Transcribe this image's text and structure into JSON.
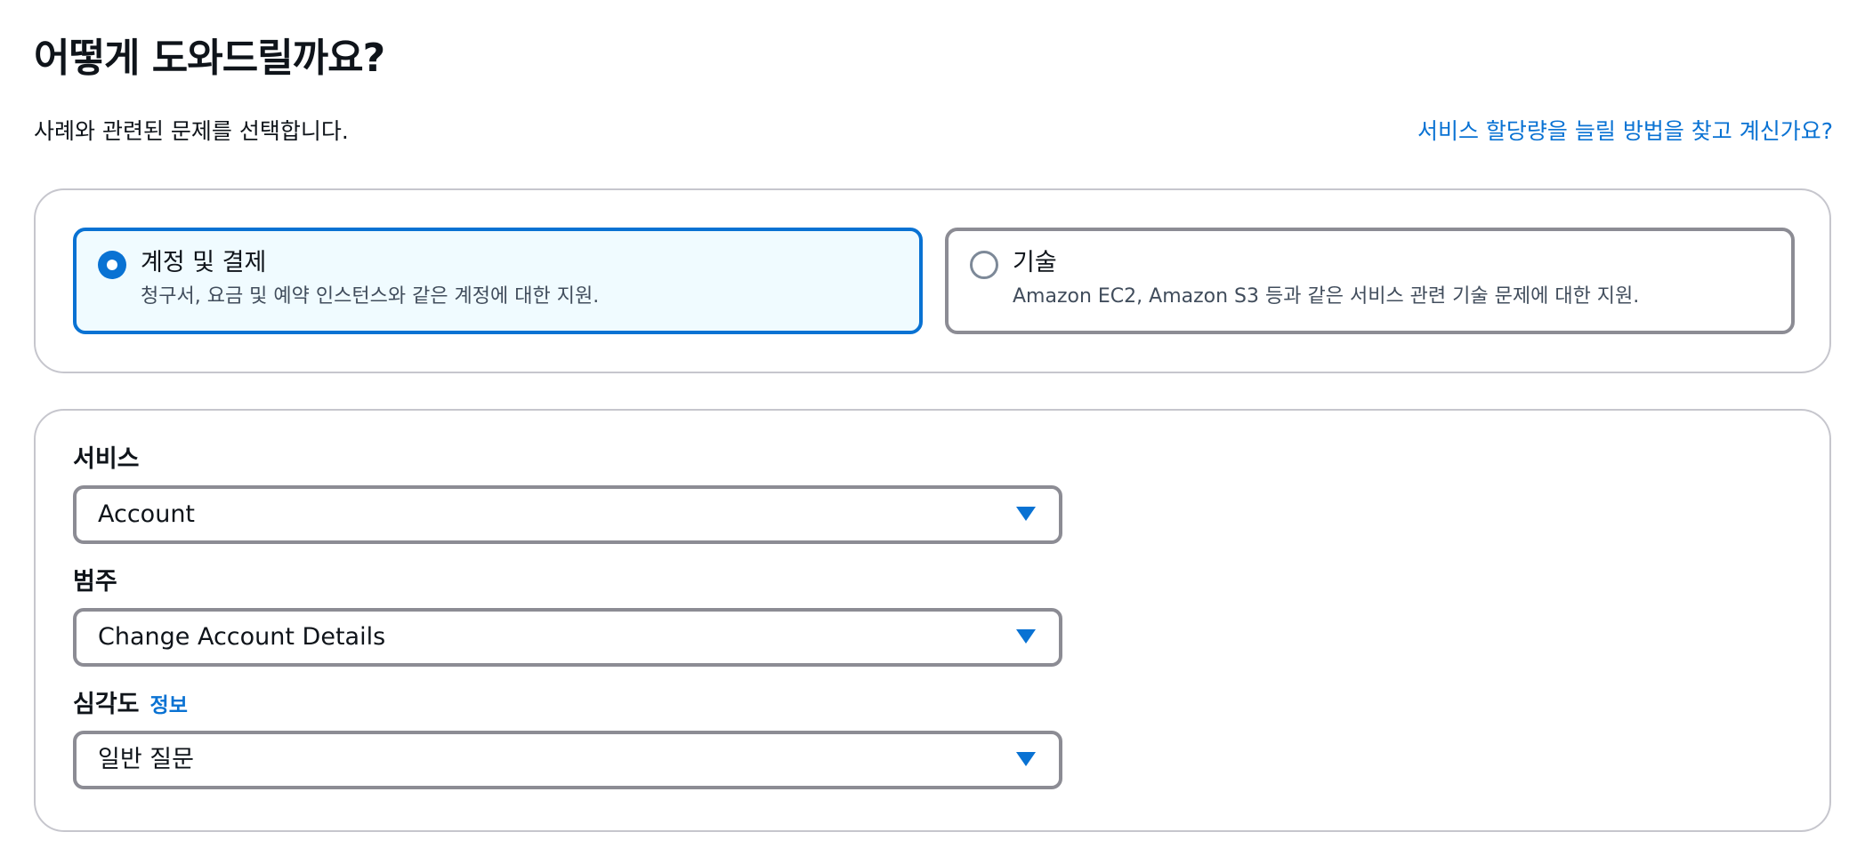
{
  "header": {
    "title": "어떻게 도와드릴까요?",
    "subtitle": "사례와 관련된 문제를 선택합니다.",
    "quota_link": "서비스 할당량을 늘릴 방법을 찾고 계신가요?"
  },
  "case_type": {
    "selected": "account_billing",
    "options": [
      {
        "label": "계정 및 결제",
        "description": "청구서, 요금 및 예약 인스턴스와 같은 계정에 대한 지원."
      },
      {
        "label": "기술",
        "description": "Amazon EC2, Amazon S3 등과 같은 서비스 관련 기술 문제에 대한 지원."
      }
    ]
  },
  "form": {
    "service": {
      "label": "서비스",
      "value": "Account"
    },
    "category": {
      "label": "범주",
      "value": "Change Account Details"
    },
    "severity": {
      "label": "심각도",
      "info_link": "정보",
      "value": "일반 질문"
    }
  },
  "colors": {
    "accent": "#0972d3",
    "selected_background": "#f0fbff",
    "border": "#8c8c94",
    "card_border": "#c6c6cd"
  },
  "icons": {
    "dropdown": "caret-down-icon",
    "radio_selected": "radio-checked-icon",
    "radio_unselected": "radio-unchecked-icon"
  }
}
